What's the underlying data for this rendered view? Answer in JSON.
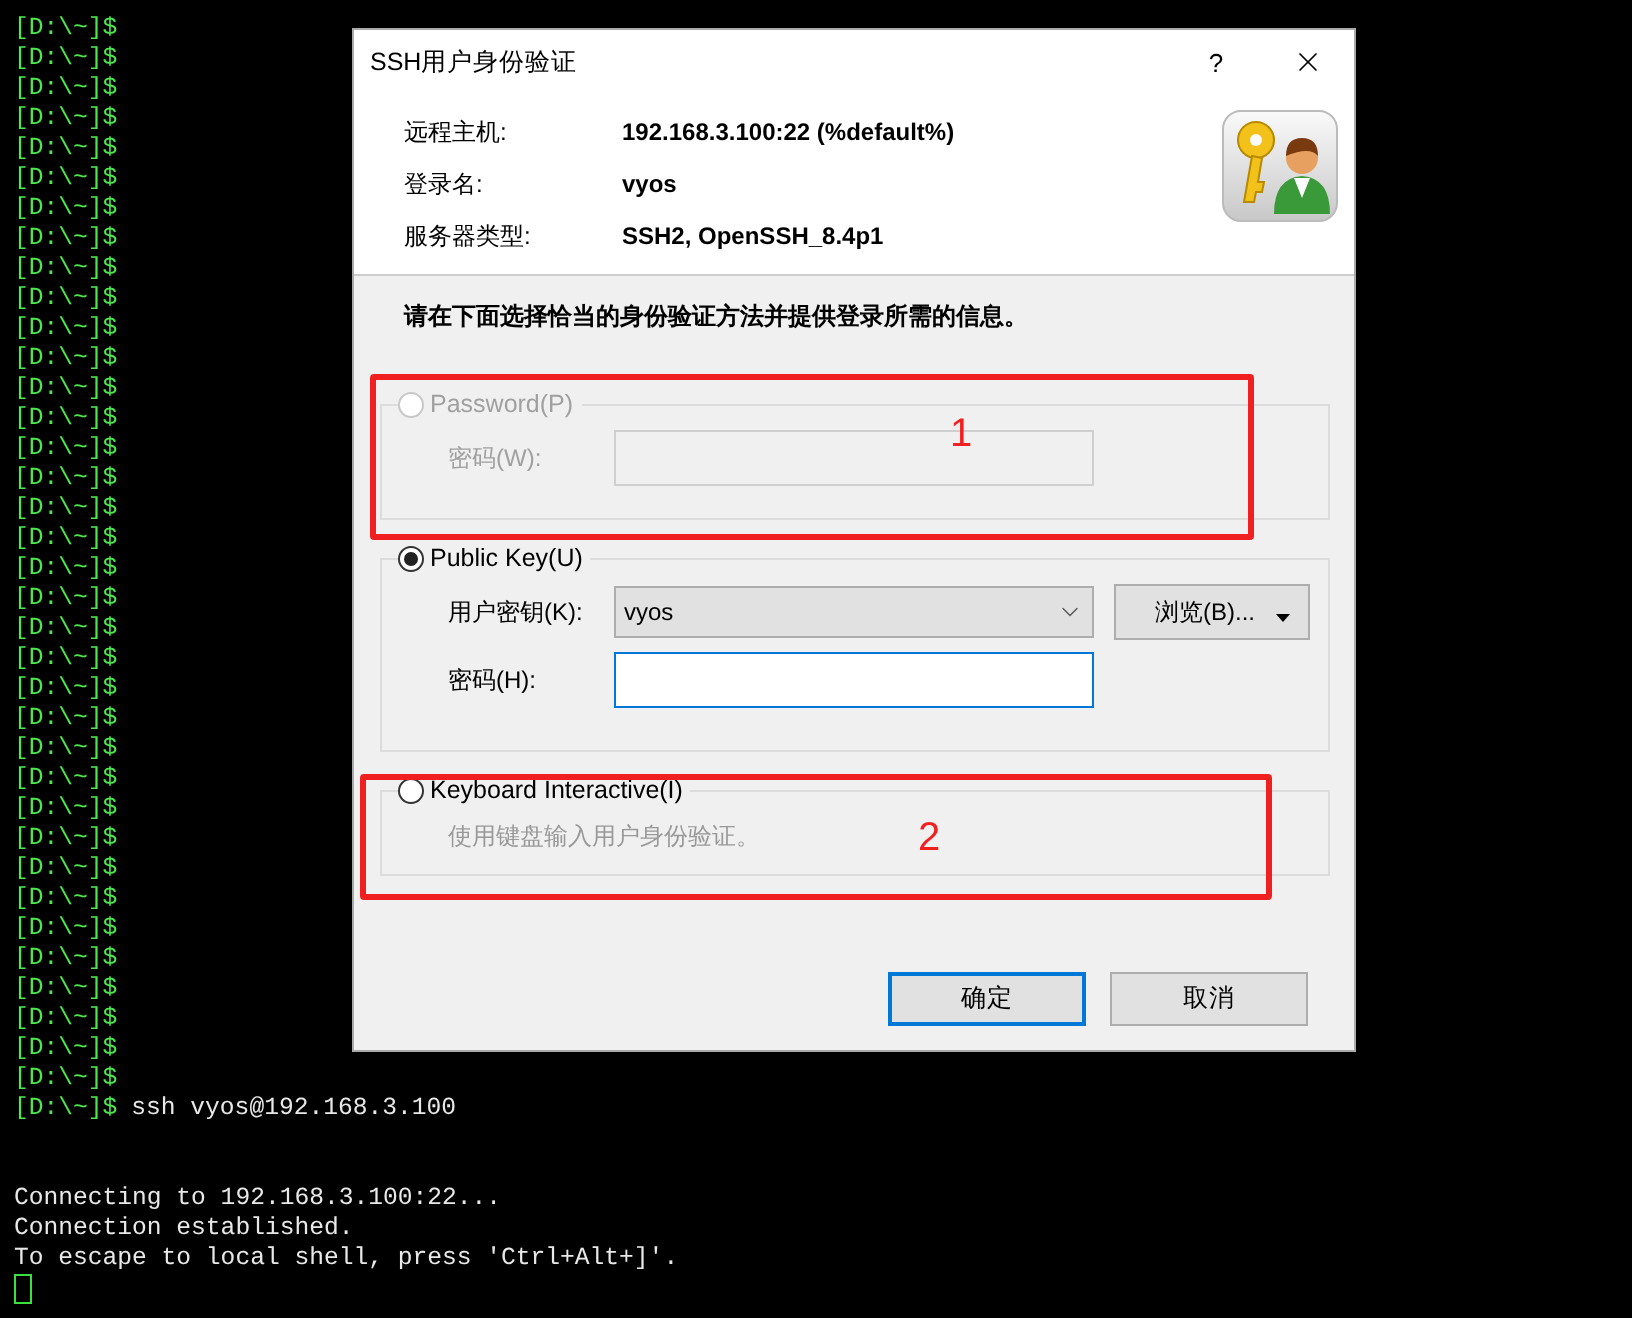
{
  "terminal": {
    "lines": [
      {
        "kind": "prompt",
        "prompt": "[D:\\~]$"
      },
      {
        "kind": "prompt",
        "prompt": "[D:\\~]$"
      },
      {
        "kind": "prompt",
        "prompt": "[D:\\~]$"
      },
      {
        "kind": "prompt",
        "prompt": "[D:\\~]$"
      },
      {
        "kind": "prompt",
        "prompt": "[D:\\~]$"
      },
      {
        "kind": "prompt",
        "prompt": "[D:\\~]$"
      },
      {
        "kind": "prompt",
        "prompt": "[D:\\~]$"
      },
      {
        "kind": "prompt",
        "prompt": "[D:\\~]$"
      },
      {
        "kind": "prompt",
        "prompt": "[D:\\~]$"
      },
      {
        "kind": "prompt",
        "prompt": "[D:\\~]$"
      },
      {
        "kind": "prompt",
        "prompt": "[D:\\~]$"
      },
      {
        "kind": "prompt",
        "prompt": "[D:\\~]$"
      },
      {
        "kind": "prompt",
        "prompt": "[D:\\~]$"
      },
      {
        "kind": "prompt",
        "prompt": "[D:\\~]$"
      },
      {
        "kind": "prompt",
        "prompt": "[D:\\~]$"
      },
      {
        "kind": "prompt",
        "prompt": "[D:\\~]$"
      },
      {
        "kind": "prompt",
        "prompt": "[D:\\~]$"
      },
      {
        "kind": "prompt",
        "prompt": "[D:\\~]$"
      },
      {
        "kind": "prompt",
        "prompt": "[D:\\~]$"
      },
      {
        "kind": "prompt",
        "prompt": "[D:\\~]$"
      },
      {
        "kind": "prompt",
        "prompt": "[D:\\~]$"
      },
      {
        "kind": "prompt",
        "prompt": "[D:\\~]$"
      },
      {
        "kind": "prompt",
        "prompt": "[D:\\~]$"
      },
      {
        "kind": "prompt",
        "prompt": "[D:\\~]$"
      },
      {
        "kind": "prompt",
        "prompt": "[D:\\~]$"
      },
      {
        "kind": "prompt",
        "prompt": "[D:\\~]$"
      },
      {
        "kind": "prompt",
        "prompt": "[D:\\~]$"
      },
      {
        "kind": "prompt",
        "prompt": "[D:\\~]$"
      },
      {
        "kind": "prompt",
        "prompt": "[D:\\~]$"
      },
      {
        "kind": "prompt",
        "prompt": "[D:\\~]$"
      },
      {
        "kind": "prompt",
        "prompt": "[D:\\~]$"
      },
      {
        "kind": "prompt",
        "prompt": "[D:\\~]$"
      },
      {
        "kind": "prompt",
        "prompt": "[D:\\~]$"
      },
      {
        "kind": "prompt",
        "prompt": "[D:\\~]$"
      },
      {
        "kind": "prompt",
        "prompt": "[D:\\~]$"
      },
      {
        "kind": "prompt",
        "prompt": "[D:\\~]$"
      },
      {
        "kind": "prompt",
        "prompt": "[D:\\~]$",
        "command": "ssh vyos@192.168.3.100"
      },
      {
        "kind": "blank"
      },
      {
        "kind": "blank"
      },
      {
        "kind": "output",
        "text": "Connecting to 192.168.3.100:22..."
      },
      {
        "kind": "output",
        "text": "Connection established."
      },
      {
        "kind": "output",
        "text": "To escape to local shell, press 'Ctrl+Alt+]'."
      },
      {
        "kind": "cursor"
      }
    ]
  },
  "dialog": {
    "title": "SSH用户身份验证",
    "help": "?",
    "info": [
      {
        "label": "远程主机:",
        "value": "192.168.3.100:22 (%default%)"
      },
      {
        "label": "登录名:",
        "value": "vyos"
      },
      {
        "label": "服务器类型:",
        "value": "SSH2, OpenSSH_8.4p1"
      }
    ],
    "instruction": "请在下面选择恰当的身份验证方法并提供登录所需的信息。",
    "methods": [
      {
        "label": "Password(P)",
        "selected": false,
        "disabled": true,
        "annotation": "1",
        "fields": [
          {
            "kind": "text",
            "label": "密码(W):",
            "focused": false
          }
        ]
      },
      {
        "label": "Public Key(U)",
        "selected": true,
        "disabled": false,
        "fields": [
          {
            "kind": "dropdown",
            "label": "用户密钥(K):",
            "value": "vyos",
            "button": "浏览(B)..."
          },
          {
            "kind": "text",
            "label": "密码(H):",
            "focused": true
          }
        ]
      },
      {
        "label": "Keyboard Interactive(I)",
        "selected": false,
        "disabled": false,
        "annotation": "2",
        "description": "使用键盘输入用户身份验证。"
      }
    ],
    "buttons": [
      {
        "label": "确定",
        "default": true
      },
      {
        "label": "取消",
        "default": false
      }
    ]
  }
}
